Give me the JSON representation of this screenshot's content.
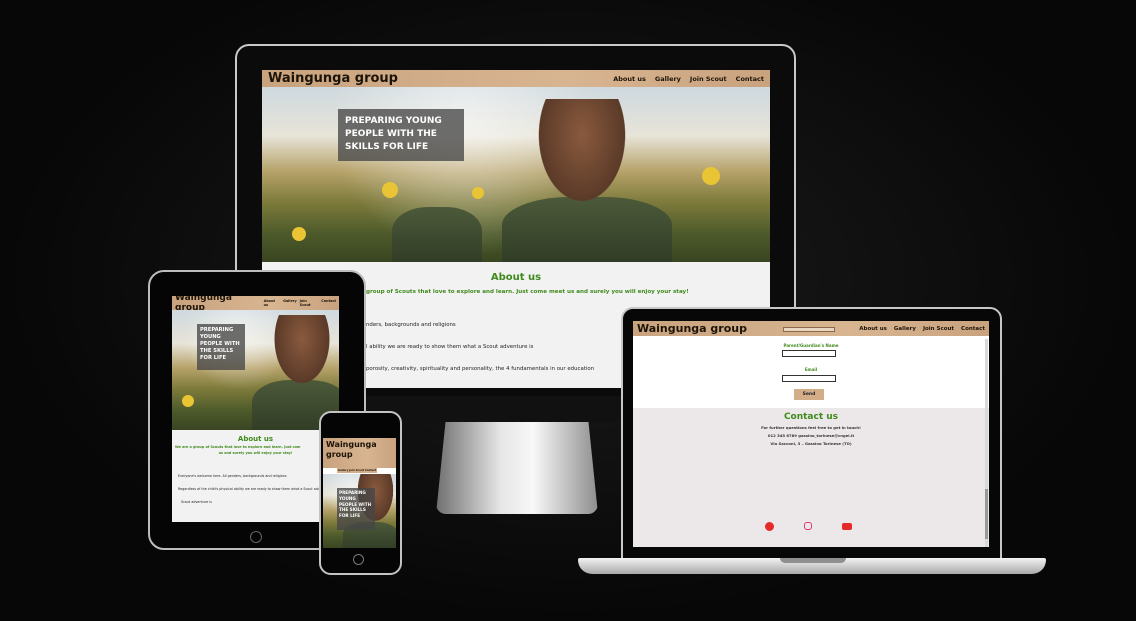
{
  "site": {
    "brand": "Waingunga group",
    "nav": [
      "About us",
      "Gallery",
      "Join Scout",
      "Contact"
    ],
    "hero_caption": "PREPARING YOUNG PEOPLE WITH THE SKILLS FOR LIFE",
    "about_title": "About us",
    "about_intro_full": "We are a group of Scouts that love to explore and learn. Just come meet us and surely you will enjoy your stay!",
    "about_intro_partial": "group of Scouts that love to explore and learn. Just come meet us and surely you will enjoy your stay!",
    "bullet1_partial": "nders, backgrounds and religions",
    "bullet2_partial": "l ability we are ready to show them what a Scout adventure is",
    "bullet3_partial": "porosity, creativity, spirituality and personality, the 4 fundamentals in our education",
    "bullet1_full": "Everyone's welcome here. All genders, backgrounds and religions",
    "bullet2_full": "Regardless of the child's physical ability we are ready to show them what a Scout adventure is",
    "ipad_intro_line1": "We are a group of Scouts that love to explore and learn. Just com",
    "ipad_intro_line2": "us and surely you will enjoy your stay!",
    "ipad_bullet2_cont": "Scout adventure is",
    "contact": {
      "field1_label": "Parent/Guardian's Name",
      "field2_label": "Email",
      "send_label": "Send",
      "title": "Contact us",
      "line1": "For further questions feel free to get in touch!",
      "line2": "012 345 6789 gassino_torinese@cngei.it",
      "line3": "Via Sacconi, 3 – Gassino Torinese (TO)"
    }
  },
  "colors": {
    "nav": "#d2ad88",
    "accent_green": "#3f8a1c",
    "send_button": "#d2ad88",
    "facebook": "#e62a2a",
    "instagram": "#e23a6a",
    "youtube": "#e62a2a"
  },
  "icons": [
    "facebook-icon",
    "instagram-icon",
    "youtube-icon"
  ]
}
